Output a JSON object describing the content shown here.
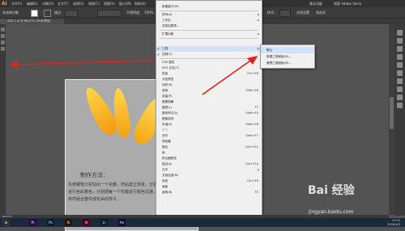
{
  "app": {
    "logo": "Ai",
    "menus": [
      "文件(F)",
      "编辑(E)",
      "对象(O)",
      "文字(T)",
      "选择(S)",
      "效果(C)",
      "视图(V)",
      "窗口(W)",
      "帮助(H)"
    ],
    "workspace": "基本功能",
    "search_placeholder": "搜索 Adobe Stock"
  },
  "control_bar": {
    "selection_label": "未选择对象",
    "stroke_label": "描边：",
    "opacity_label": "不透明度：",
    "opacity_value": "100%",
    "style_label": "样式：",
    "doc_setup_button": "文档设置",
    "prefs_button": "首选项"
  },
  "document_tab": {
    "label": "AD4-1.ai @ 66.67% (RGB/预览)"
  },
  "artboard": {
    "heading": "制作方法：",
    "body": "先用钢笔分别勾出一个花瓣，然后建立渐变，分别设置三个色等三种进行色彩着色，分别把每一个花瓣进行颜色过渡，最后按照顺序行序依然组合整件成花朵的样子。"
  },
  "context_menu": {
    "items": [
      {
        "label": "新建窗口(W)",
        "shortcut": "",
        "arrow": false
      },
      {
        "sep": true
      },
      {
        "label": "排列(A)",
        "shortcut": "",
        "arrow": true
      },
      {
        "label": "工作区",
        "shortcut": "",
        "arrow": true
      },
      {
        "label": "浏览加载项...",
        "shortcut": "",
        "arrow": false
      },
      {
        "sep": true
      },
      {
        "label": "扩展功能",
        "shortcut": "",
        "arrow": true
      },
      {
        "sep": true
      },
      {
        "label": "工具",
        "shortcut": "",
        "arrow": true,
        "highlight": true,
        "check": true
      },
      {
        "label": "控制(C)",
        "shortcut": "",
        "arrow": false,
        "check": true
      },
      {
        "sep": true
      },
      {
        "label": "CSS 属性",
        "shortcut": "",
        "arrow": false
      },
      {
        "label": "SVG 交互(Y)",
        "shortcut": "",
        "arrow": false
      },
      {
        "label": "信息",
        "shortcut": "Ctrl+F8",
        "arrow": false
      },
      {
        "label": "分色预览",
        "shortcut": "",
        "arrow": false
      },
      {
        "label": "动作(N)",
        "shortcut": "",
        "arrow": false
      },
      {
        "label": "变换",
        "shortcut": "Shift+F8",
        "arrow": false
      },
      {
        "label": "变量(R)",
        "shortcut": "",
        "arrow": false
      },
      {
        "label": "图像描摹",
        "shortcut": "",
        "arrow": false
      },
      {
        "label": "图层(L)",
        "shortcut": "F7",
        "arrow": false
      },
      {
        "label": "图形样式(S)",
        "shortcut": "Shift+F5",
        "arrow": false
      },
      {
        "label": "图案选项",
        "shortcut": "",
        "arrow": false
      },
      {
        "label": "外观(E)",
        "shortcut": "Shift+F6",
        "arrow": false
      },
      {
        "label": "学习",
        "shortcut": "",
        "arrow": false,
        "dim": true
      },
      {
        "label": "对齐",
        "shortcut": "Shift+F7",
        "arrow": false
      },
      {
        "label": "导航器",
        "shortcut": "",
        "arrow": false
      },
      {
        "label": "属性",
        "shortcut": "Ctrl+F11",
        "arrow": false
      },
      {
        "label": "库",
        "shortcut": "",
        "arrow": false
      },
      {
        "label": "拼合器预览",
        "shortcut": "",
        "arrow": false
      },
      {
        "label": "描边(K)",
        "shortcut": "Ctrl+F10",
        "arrow": false
      },
      {
        "label": "文字",
        "shortcut": "",
        "arrow": true
      },
      {
        "label": "文档信息(M)",
        "shortcut": "",
        "arrow": false
      },
      {
        "label": "渐变",
        "shortcut": "Ctrl+F9",
        "arrow": false
      },
      {
        "label": "画板",
        "shortcut": "",
        "arrow": false
      },
      {
        "label": "画笔(B)",
        "shortcut": "F5",
        "arrow": false
      }
    ]
  },
  "submenu": {
    "items": [
      {
        "label": "默认",
        "highlight": true
      },
      {
        "label": "新建工具面板(N)...",
        "highlight": false
      },
      {
        "label": "管理工具面板(M)...",
        "highlight": false
      }
    ]
  },
  "status": {
    "zoom": "66.67%"
  },
  "taskbar": {
    "apps": [
      {
        "label": "Pr",
        "color": "#2a0a4a"
      },
      {
        "label": "Ps",
        "color": "#061e3a"
      },
      {
        "label": "Ai",
        "color": "#2b1500"
      },
      {
        "label": "Id",
        "color": "#49021f"
      },
      {
        "label": "Lr",
        "color": "#0a2030"
      },
      {
        "label": "Ae",
        "color": "#1a0a3a"
      }
    ],
    "time": "12:10",
    "date": "2020/4/3"
  },
  "watermark": {
    "brand": "Bai 经验",
    "url": "jingyan.baidu.com"
  }
}
